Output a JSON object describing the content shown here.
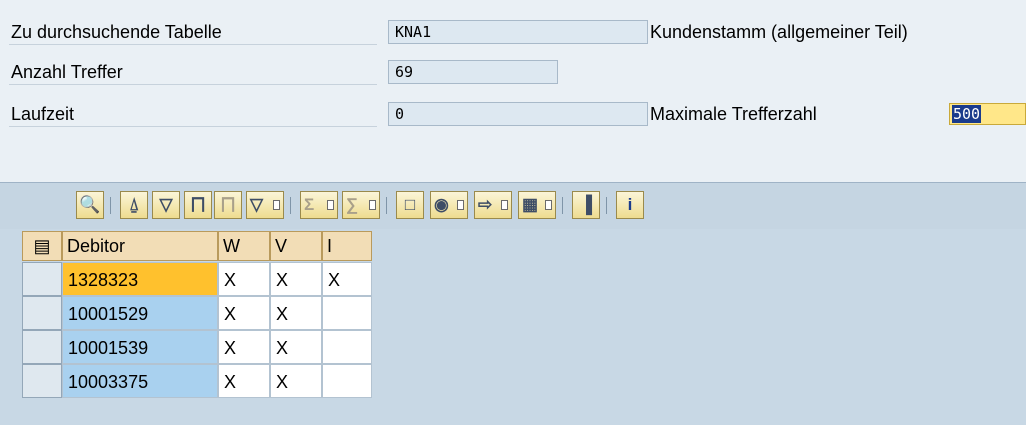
{
  "header": {
    "table_label": "Zu durchsuchende Tabelle",
    "table_value": "KNA1",
    "table_description": "Kundenstamm (allgemeiner Teil)",
    "hits_label": "Anzahl Treffer",
    "hits_value": "69",
    "runtime_label": "Laufzeit",
    "runtime_value": "0",
    "max_hits_label": "Maximale Trefferzahl",
    "max_hits_value": "500"
  },
  "toolbar": {
    "buttons": [
      "details-icon",
      "print-icon",
      "filter-funnel-icon",
      "find-icon",
      "find-next-icon",
      "set-filter-icon",
      "sum-icon",
      "subtotal-icon",
      "print-preview-icon",
      "export-icon",
      "local-file-icon",
      "layout-columns-icon",
      "graphic-icon",
      "info-icon"
    ]
  },
  "table": {
    "columns": [
      "Debitor",
      "W",
      "V",
      "I"
    ],
    "rows": [
      {
        "debitor": "1328323",
        "w": "X",
        "v": "X",
        "i": "X"
      },
      {
        "debitor": "10001529",
        "w": "X",
        "v": "X",
        "i": ""
      },
      {
        "debitor": "10001539",
        "w": "X",
        "v": "X",
        "i": ""
      },
      {
        "debitor": "10003375",
        "w": "X",
        "v": "X",
        "i": ""
      }
    ]
  },
  "colors": {
    "background": "#eaf0f5",
    "key_cell": "#a9d1ef",
    "selected_key_cell": "#ffc12d",
    "header_cell": "#f2ddb6",
    "active_field": "#ffe789"
  }
}
